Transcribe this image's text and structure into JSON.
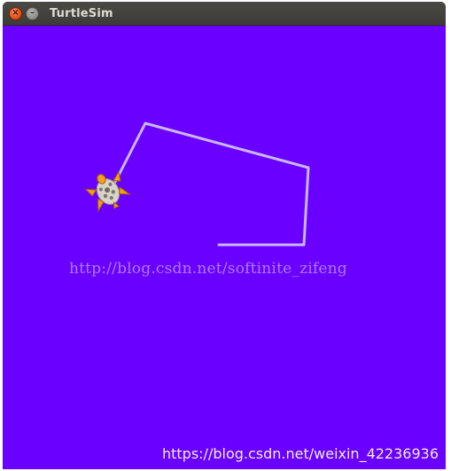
{
  "window": {
    "title": "TurtleSim",
    "background_color": "#6a00ff"
  },
  "titlebar": {
    "close_icon": "×",
    "minimize_icon": "–"
  },
  "scene": {
    "path_color": "#c9b7ff",
    "turtle_shell_color": "#d8d3c8",
    "turtle_limb_color": "#f1a020"
  },
  "watermarks": {
    "center_text": "http://blog.csdn.net/softinite_zifeng",
    "bottom_right_text": "https://blog.csdn.net/weixin_42236936"
  }
}
